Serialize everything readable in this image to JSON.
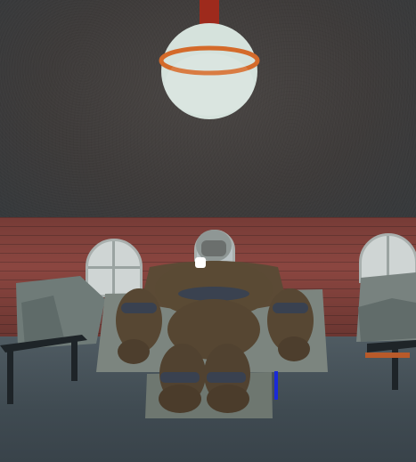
{
  "game": {
    "scene_name": "",
    "hud_text": ""
  },
  "colors": {
    "ceiling": "#403d3c",
    "brick_wall": "#8a463f",
    "floor": "#46525a",
    "lamp_globe": "#d8e4de",
    "lamp_ring": "#d66a2a",
    "lamp_rod": "#a32618",
    "mech": "#5a4a35",
    "mech_joints": "#3a4250",
    "hud_bar": "#1a2ad8",
    "crosshair": "#ffffff"
  },
  "icons": {
    "crosshair": "crosshair-icon",
    "hud_meter": "meter-icon"
  }
}
